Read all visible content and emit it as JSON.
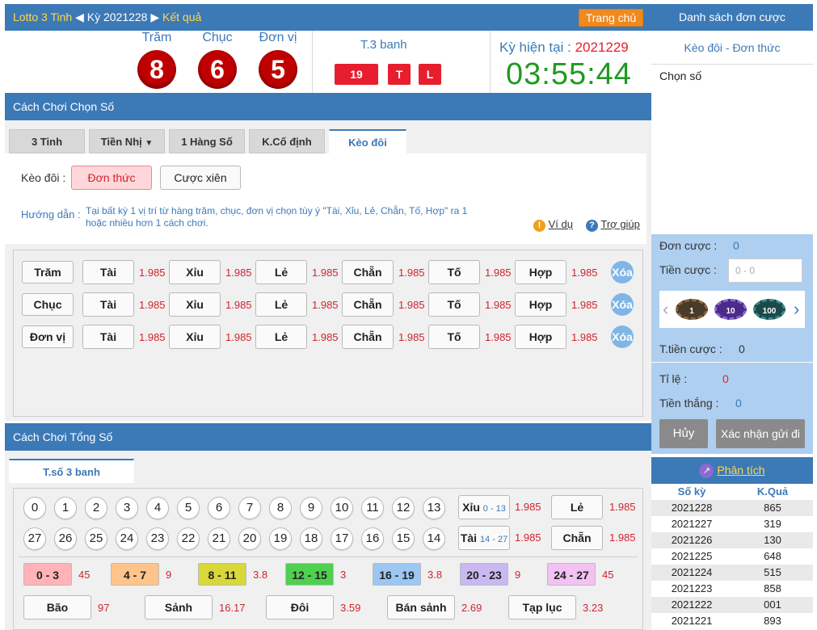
{
  "header": {
    "game": "Lotto 3 Tinh",
    "ky_label": "Kỳ 2021228",
    "result_label": "Kết quả",
    "home": "Trang chủ"
  },
  "result": {
    "cols": [
      "Trăm",
      "Chục",
      "Đơn vị"
    ],
    "balls": [
      "8",
      "6",
      "5"
    ],
    "t3_label": "T.3 banh",
    "t3_values": [
      "19",
      "T",
      "L"
    ],
    "current_label": "Kỳ hiện tại :",
    "current_ky": "2021229",
    "clock": "03:55:44"
  },
  "section1": {
    "title": "Cách Chơi Chọn Số",
    "tabs": [
      "3 Tinh",
      "Tiền Nhị",
      "1 Hàng Số",
      "K.Cố định",
      "Kèo đôi"
    ],
    "keodoi_label": "Kèo đôi :",
    "btn_single": "Đơn thức",
    "btn_multi": "Cược xiên",
    "guide_label": "Hướng dẫn :",
    "guide_text": "Tại bất kỳ 1 vị trí từ hàng trăm, chục, đơn vị chọn tùy ý \"Tài, Xỉu, Lẻ, Chẵn, Tố, Hợp\" ra 1 hoặc nhiều hơn 1 cách chơi.",
    "example": "Ví dụ",
    "help": "Trợ giúp",
    "rows": [
      {
        "label": "Trăm"
      },
      {
        "label": "Chục"
      },
      {
        "label": "Đơn vị"
      }
    ],
    "options": [
      "Tài",
      "Xỉu",
      "Lẻ",
      "Chẵn",
      "Tố",
      "Hợp"
    ],
    "odd": "1.985",
    "clear": "Xóa"
  },
  "section2": {
    "title": "Cách Chơi Tổng Số",
    "tab": "T.số 3 banh",
    "row1": [
      "0",
      "1",
      "2",
      "3",
      "4",
      "5",
      "6",
      "7",
      "8",
      "9",
      "10",
      "11",
      "12",
      "13"
    ],
    "row2": [
      "27",
      "26",
      "25",
      "24",
      "23",
      "22",
      "21",
      "20",
      "19",
      "18",
      "17",
      "16",
      "15",
      "14"
    ],
    "xiu": {
      "label": "Xỉu",
      "range": "0 - 13",
      "odd": "1.985"
    },
    "le": {
      "label": "Lẻ",
      "odd": "1.985"
    },
    "tai": {
      "label": "Tài",
      "range": "14 - 27",
      "odd": "1.985"
    },
    "chan": {
      "label": "Chẵn",
      "odd": "1.985"
    },
    "ranges": [
      {
        "label": "0 - 3",
        "odd": "45",
        "color": "#ffb3b8"
      },
      {
        "label": "4 - 7",
        "odd": "9",
        "color": "#ffc48a"
      },
      {
        "label": "8 - 11",
        "odd": "3.8",
        "color": "#d8d83a"
      },
      {
        "label": "12 - 15",
        "odd": "3",
        "color": "#4fd04f"
      },
      {
        "label": "16 - 19",
        "odd": "3.8",
        "color": "#9cc7f2"
      },
      {
        "label": "20 - 23",
        "odd": "9",
        "color": "#c9b8f2"
      },
      {
        "label": "24 - 27",
        "odd": "45",
        "color": "#f2c2f2"
      }
    ],
    "specials": [
      {
        "label": "Bão",
        "odd": "97"
      },
      {
        "label": "Sảnh",
        "odd": "16.17"
      },
      {
        "label": "Đôi",
        "odd": "3.59"
      },
      {
        "label": "Bán sảnh",
        "odd": "2.69"
      },
      {
        "label": "Tạp lục",
        "odd": "3.23"
      }
    ]
  },
  "right": {
    "title": "Danh sách đơn cược",
    "subtitle": "Kèo đôi - Đơn thức",
    "choose": "Chọn số",
    "don_cuoc_label": "Đơn cược :",
    "don_cuoc": "0",
    "tien_cuoc_label": "Tiền cược :",
    "tien_cuoc_ph": "0 - 0",
    "chips": [
      "1",
      "10",
      "100"
    ],
    "total_label": "T.tiền cược :",
    "total": "0",
    "ti_le_label": "Tỉ lệ :",
    "ti_le": "0",
    "tien_thang_label": "Tiền thắng :",
    "tien_thang": "0",
    "cancel": "Hủy",
    "confirm": "Xác nhận gửi đi",
    "analysis": "Phân tích",
    "hist_head": [
      "Số kỳ",
      "K.Quả"
    ],
    "history": [
      [
        "2021228",
        "865"
      ],
      [
        "2021227",
        "319"
      ],
      [
        "2021226",
        "130"
      ],
      [
        "2021225",
        "648"
      ],
      [
        "2021224",
        "515"
      ],
      [
        "2021223",
        "858"
      ],
      [
        "2021222",
        "001"
      ],
      [
        "2021221",
        "893"
      ]
    ]
  }
}
